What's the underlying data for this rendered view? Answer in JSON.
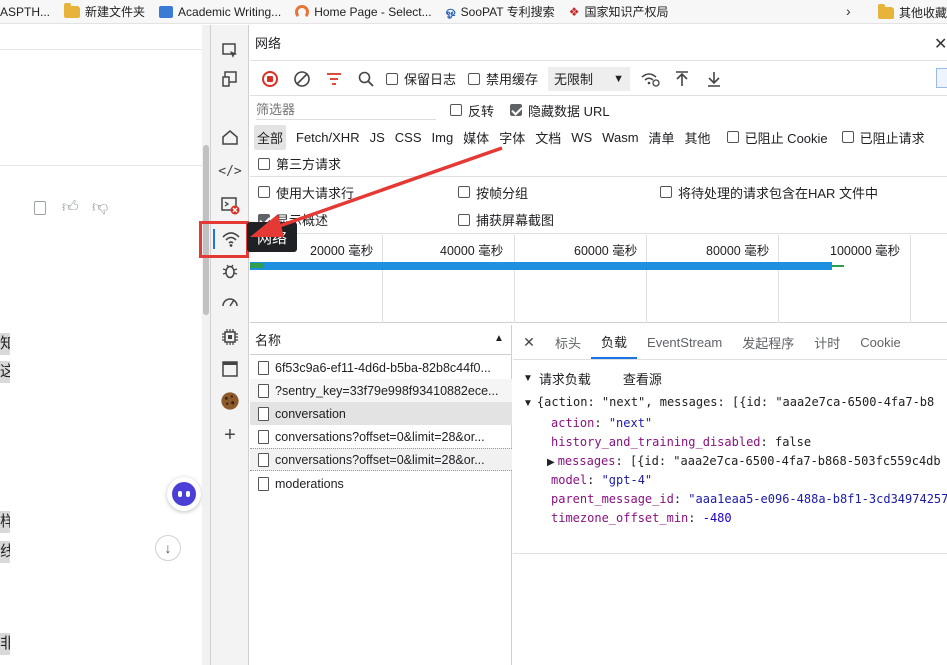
{
  "bookmarks": [
    "ASPTH...",
    "新建文件夹",
    "Academic Writing...",
    "Home Page - Select...",
    "SooPAT 专利搜索",
    "国家知识产权局",
    "其他收藏"
  ],
  "left_pane": {
    "chars": [
      "知",
      "这",
      "样",
      "线",
      "非"
    ]
  },
  "panel": {
    "title": "网络",
    "toolbar": {
      "preserve_log": "保留日志",
      "disable_cache": "禁用缓存",
      "throttle": "无限制"
    },
    "filter": {
      "placeholder": "筛选器",
      "invert": "反转",
      "hide_data_urls": "隐藏数据 URL",
      "types": [
        "全部",
        "Fetch/XHR",
        "JS",
        "CSS",
        "Img",
        "媒体",
        "字体",
        "文档",
        "WS",
        "Wasm",
        "清单",
        "其他"
      ],
      "blocked_cookies": "已阻止 Cookie",
      "blocked_requests": "已阻止请求",
      "third_party": "第三方请求"
    },
    "settings": {
      "large_rows": "使用大请求行",
      "group_by_frame": "按帧分组",
      "har_pending": "将待处理的请求包含在HAR 文件中",
      "show_overview": "显示概述",
      "capture_screenshots": "捕获屏幕截图"
    },
    "tooltip": "网络",
    "timeline": {
      "ticks": [
        "20000 毫秒",
        "40000 毫秒",
        "60000 毫秒",
        "80000 毫秒",
        "100000 毫秒"
      ]
    },
    "requests": {
      "header": "名称",
      "items": [
        "6f53c9a6-ef11-4d6d-b5ba-82b8c44f0...",
        "?sentry_key=33f79e998f93410882ece...",
        "conversation",
        "conversations?offset=0&limit=28&or...",
        "conversations?offset=0&limit=28&or...",
        "moderations"
      ]
    },
    "detail": {
      "tabs": [
        "标头",
        "负载",
        "EventStream",
        "发起程序",
        "计时",
        "Cookie"
      ],
      "section": "请求负载",
      "view_source": "查看源",
      "payload_summary": "{action: \"next\", messages: [{id: \"aaa2e7ca-6500-4fa7-b8",
      "fields": [
        {
          "key": "action",
          "value": "\"next\"",
          "kind": "str"
        },
        {
          "key": "history_and_training_disabled",
          "value": "false",
          "kind": "num"
        },
        {
          "key": "messages",
          "value": "[{id: \"aaa2e7ca-6500-4fa7-b868-503fc559c4db",
          "kind": "plain"
        },
        {
          "key": "model",
          "value": "\"gpt-4\"",
          "kind": "str"
        },
        {
          "key": "parent_message_id",
          "value": "\"aaa1eaa5-e096-488a-b8f1-3cd34974257",
          "kind": "str"
        },
        {
          "key": "timezone_offset_min",
          "value": "-480",
          "kind": "num"
        }
      ]
    }
  },
  "colors": {
    "accent": "#1a73e8",
    "annotation": "#e53935",
    "record": "#d93025"
  }
}
